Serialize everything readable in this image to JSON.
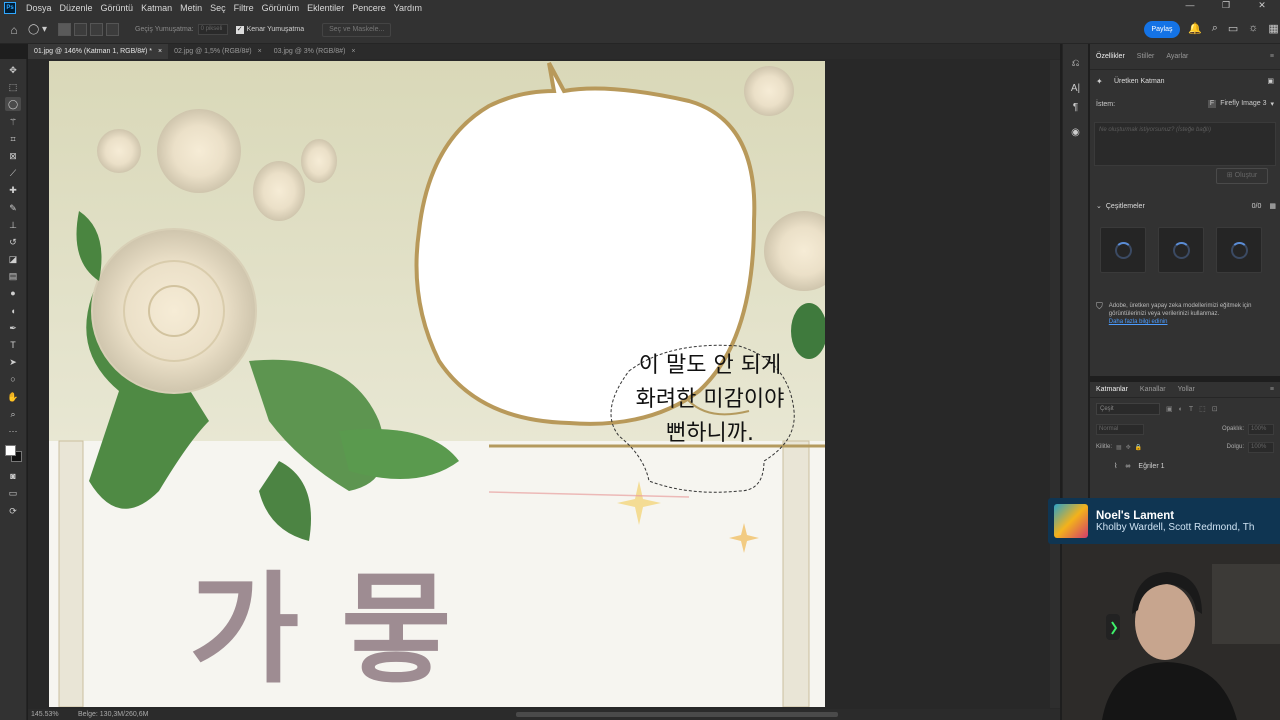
{
  "app": {
    "logo": "Ps",
    "menu": [
      "Dosya",
      "Düzenle",
      "Görüntü",
      "Katman",
      "Metin",
      "Seç",
      "Filtre",
      "Görünüm",
      "Eklentiler",
      "Pencere",
      "Yardım"
    ]
  },
  "options": {
    "feather_label": "Geçiş Yumuşatma:",
    "feather_value": "0 pikseli",
    "antialias_label": "Kenar Yumuşatma",
    "select_mask_label": "Seç ve Maskele...",
    "share_label": "Paylaş"
  },
  "tabs": [
    {
      "label": "01.jpg @ 146% (Katman 1, RGB/8#) *",
      "active": true
    },
    {
      "label": "02.jpg @ 1,5% (RGB/8#)",
      "active": false
    },
    {
      "label": "03.jpg @ 3% (RGB/8#)",
      "active": false
    }
  ],
  "tools": [
    "move-tool",
    "marquee-tool",
    "lasso-tool",
    "magic-wand-tool",
    "crop-tool",
    "frame-tool",
    "eyedropper-tool",
    "healing-tool",
    "brush-tool",
    "stamp-tool",
    "history-brush-tool",
    "eraser-tool",
    "gradient-tool",
    "blur-tool",
    "dodge-tool",
    "pen-tool",
    "type-tool",
    "path-select-tool",
    "shape-tool",
    "hand-tool",
    "zoom-tool",
    "more-tools"
  ],
  "artwork": {
    "korean_lines": [
      "이 말도 안 되게",
      "화려한 미감이야",
      "뻔하니까."
    ],
    "title_text": "가 뭏"
  },
  "status": {
    "zoom": "145.53%",
    "doc_info": "Belge: 130,3M/260,6M"
  },
  "properties": {
    "tabs": [
      "Özellikler",
      "Stiller",
      "Ayarlar"
    ],
    "layer_type": "Üretken Katman",
    "prompt_label": "İstem:",
    "model": "Firefly Image 3",
    "prompt_placeholder": "Ne oluşturmak istiyorsunuz? (İsteğe bağlı)",
    "create_label": "Oluştur",
    "variations_label": "Çeşitlemeler",
    "variations_count": "0/0",
    "notice_text": "Adobe, üretken yapay zeka modellerimizi eğitmek için görüntülerinizi veya verilerinizi kullanmaz.",
    "notice_link": "Daha fazla bilgi edinin"
  },
  "layers": {
    "tabs": [
      "Katmanlar",
      "Kanallar",
      "Yollar"
    ],
    "search_placeholder": "Çeşit",
    "blend_mode": "Normal",
    "opacity_label": "Opaklık:",
    "opacity_value": "100%",
    "lock_label": "Kilitle:",
    "fill_label": "Dolgu:",
    "fill_value": "100%",
    "items": [
      {
        "name": "Eğriler 1"
      }
    ]
  },
  "now_playing": {
    "title": "Noel's Lament",
    "artists": "Kholby Wardell, Scott Redmond, Th"
  },
  "colors": {
    "accent": "#1473e6",
    "link": "#4b9cff",
    "now_playing_bg": "#0f3552"
  }
}
